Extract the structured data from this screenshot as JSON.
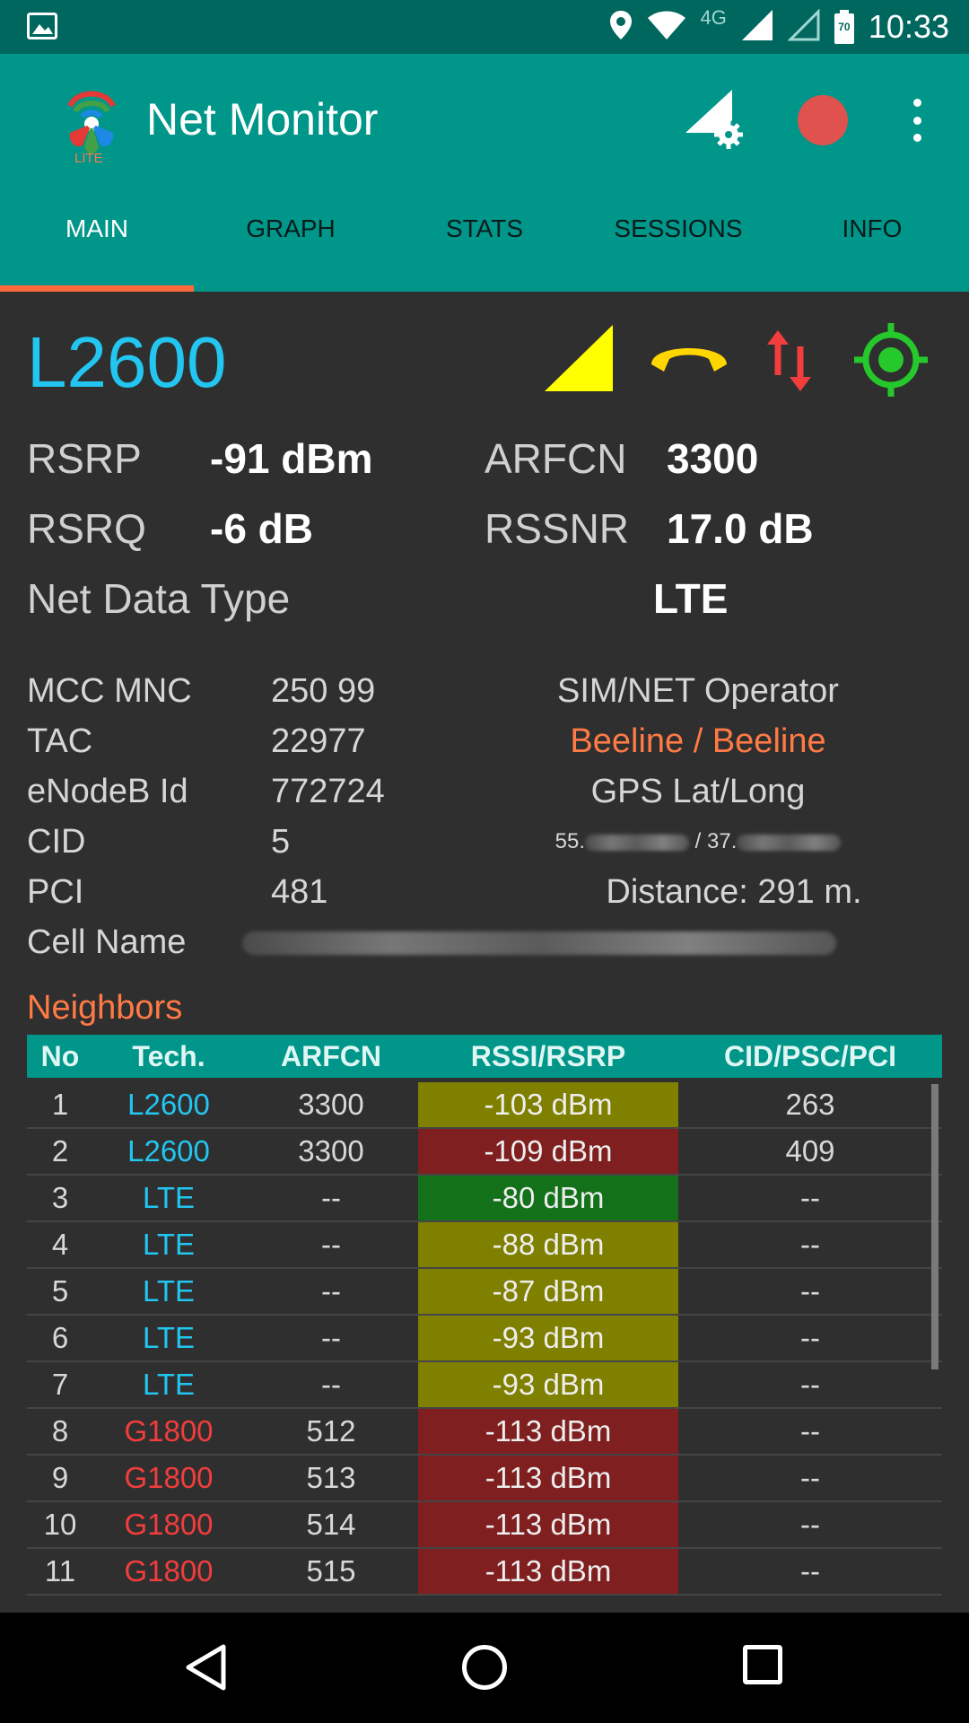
{
  "status_bar": {
    "time": "10:33",
    "network_badge": "4G",
    "battery_level": "70",
    "icons": [
      "image-icon",
      "location-icon",
      "wifi-icon",
      "signal-icon",
      "signal-empty-icon",
      "battery-icon"
    ]
  },
  "app": {
    "title": "Net Monitor",
    "logo_badge": "LITE",
    "actions": [
      "signal-settings-icon",
      "record-icon",
      "overflow-menu-icon"
    ]
  },
  "tabs": [
    {
      "label": "MAIN",
      "active": true
    },
    {
      "label": "GRAPH",
      "active": false
    },
    {
      "label": "STATS",
      "active": false
    },
    {
      "label": "SESSIONS",
      "active": false
    },
    {
      "label": "INFO",
      "active": false
    }
  ],
  "main": {
    "technology": "L2600",
    "rsrp_label": "RSRP",
    "rsrp_value": "-91 dBm",
    "arfcn_label": "ARFCN",
    "arfcn_value": "3300",
    "rsrq_label": "RSRQ",
    "rsrq_value": "-6 dB",
    "rssnr_label": "RSSNR",
    "rssnr_value": "17.0 dB",
    "net_data_type_label": "Net Data Type",
    "net_data_type_value": "LTE"
  },
  "cell_info": {
    "mcc_mnc_label": "MCC MNC",
    "mcc_mnc_value": "250 99",
    "tac_label": "TAC",
    "tac_value": "22977",
    "enodeb_label": "eNodeB Id",
    "enodeb_value": "772724",
    "cid_label": "CID",
    "cid_value": "5",
    "pci_label": "PCI",
    "pci_value": "481",
    "cell_name_label": "Cell Name",
    "operator_label": "SIM/NET Operator",
    "operator_value": "Beeline / Beeline",
    "gps_label": "GPS Lat/Long",
    "gps_lat_prefix": "55.",
    "gps_long_prefix": "/ 37.",
    "distance": "Distance: 291 m."
  },
  "neighbors": {
    "title": "Neighbors",
    "headers": [
      "No",
      "Tech.",
      "ARFCN",
      "RSSI/RSRP",
      "CID/PSC/PCI"
    ],
    "rows": [
      {
        "no": "1",
        "tech": "L2600",
        "arfcn": "3300",
        "rssi": "-103 dBm",
        "cid": "263",
        "tech_color": "#22c6f0",
        "rssi_color": "#808000"
      },
      {
        "no": "2",
        "tech": "L2600",
        "arfcn": "3300",
        "rssi": "-109 dBm",
        "cid": "409",
        "tech_color": "#22c6f0",
        "rssi_color": "#7f1f1f"
      },
      {
        "no": "3",
        "tech": "LTE",
        "arfcn": "--",
        "rssi": "-80 dBm",
        "cid": "--",
        "tech_color": "#22c6f0",
        "rssi_color": "#13711a"
      },
      {
        "no": "4",
        "tech": "LTE",
        "arfcn": "--",
        "rssi": "-88 dBm",
        "cid": "--",
        "tech_color": "#22c6f0",
        "rssi_color": "#808000"
      },
      {
        "no": "5",
        "tech": "LTE",
        "arfcn": "--",
        "rssi": "-87 dBm",
        "cid": "--",
        "tech_color": "#22c6f0",
        "rssi_color": "#808000"
      },
      {
        "no": "6",
        "tech": "LTE",
        "arfcn": "--",
        "rssi": "-93 dBm",
        "cid": "--",
        "tech_color": "#22c6f0",
        "rssi_color": "#808000"
      },
      {
        "no": "7",
        "tech": "LTE",
        "arfcn": "--",
        "rssi": "-93 dBm",
        "cid": "--",
        "tech_color": "#22c6f0",
        "rssi_color": "#808000"
      },
      {
        "no": "8",
        "tech": "G1800",
        "arfcn": "512",
        "rssi": "-113 dBm",
        "cid": "--",
        "tech_color": "#f23d3d",
        "rssi_color": "#7f1f1f"
      },
      {
        "no": "9",
        "tech": "G1800",
        "arfcn": "513",
        "rssi": "-113 dBm",
        "cid": "--",
        "tech_color": "#f23d3d",
        "rssi_color": "#7f1f1f"
      },
      {
        "no": "10",
        "tech": "G1800",
        "arfcn": "514",
        "rssi": "-113 dBm",
        "cid": "--",
        "tech_color": "#f23d3d",
        "rssi_color": "#7f1f1f"
      },
      {
        "no": "11",
        "tech": "G1800",
        "arfcn": "515",
        "rssi": "-113 dBm",
        "cid": "--",
        "tech_color": "#f23d3d",
        "rssi_color": "#7f1f1f"
      }
    ]
  },
  "colors": {
    "app_bar": "#00968a",
    "status_bar": "#00675f",
    "tab_indicator": "#ff6a3d",
    "technology": "#22c6f0",
    "operator": "#ff7a45",
    "signal_triangle": "#ffff00",
    "call_icon": "#ffd600",
    "data_arrows": "#f23d3d",
    "gps_icon": "#26c92b"
  },
  "nav_bar": {
    "icons": [
      "back-icon",
      "home-icon",
      "recents-icon"
    ]
  }
}
